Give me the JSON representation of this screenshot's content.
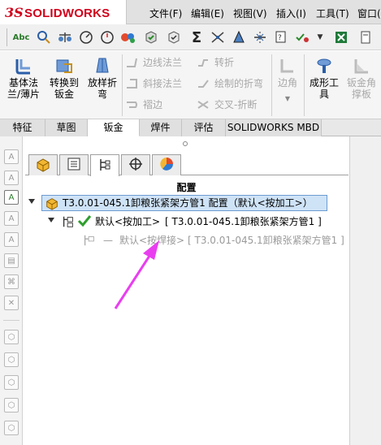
{
  "app": {
    "logo_ds": "3S",
    "logo_text": "SOLIDWORKS",
    "menus": [
      "文件(F)",
      "编辑(E)",
      "视图(V)",
      "插入(I)",
      "工具(T)",
      "窗口("
    ]
  },
  "ribbon": {
    "big_buttons": [
      {
        "label": "基体法\n兰/薄片",
        "enabled": true
      },
      {
        "label": "转换到\n钣金",
        "enabled": true
      },
      {
        "label": "放样折\n弯",
        "enabled": true
      },
      {
        "label": "边角",
        "enabled": false
      },
      {
        "label": "成形工\n具",
        "enabled": true
      },
      {
        "label": "钣金角\n撑板",
        "enabled": false
      }
    ],
    "small_buttons": [
      {
        "label": "边线法兰",
        "enabled": false
      },
      {
        "label": "斜接法兰",
        "enabled": false
      },
      {
        "label": "褶边",
        "enabled": false
      },
      {
        "label": "转折",
        "enabled": false
      },
      {
        "label": "绘制的折弯",
        "enabled": false
      },
      {
        "label": "交叉-折断",
        "enabled": false
      }
    ]
  },
  "tabs": [
    {
      "label": "特征",
      "active": false
    },
    {
      "label": "草图",
      "active": false
    },
    {
      "label": "钣金",
      "active": true
    },
    {
      "label": "焊件",
      "active": false
    },
    {
      "label": "评估",
      "active": false
    },
    {
      "label": "SOLIDWORKS MBD",
      "active": false
    }
  ],
  "feature_manager": {
    "tabs": [
      "feature-tree-icon",
      "property-manager-icon",
      "configuration-manager-icon",
      "dimxpert-icon",
      "display-manager-icon"
    ],
    "active_tab_index": 2,
    "title": "配置",
    "root": "T3.0.01-045.1卸粮张紧架方管1 配置（默认<按加工>）",
    "child": {
      "name": "默认<按加工>",
      "detail": "[ T3.0.01-045.1卸粮张紧架方管1 ]"
    },
    "grandchild": {
      "name": "默认<按焊接>",
      "detail": "[ T3.0.01-045.1卸粮张紧架方管1 ]"
    }
  },
  "colors": {
    "brand": "#d0021b",
    "selection": "#cfe3f7",
    "arrow": "#e93ef0",
    "check": "#2e9e2e"
  }
}
